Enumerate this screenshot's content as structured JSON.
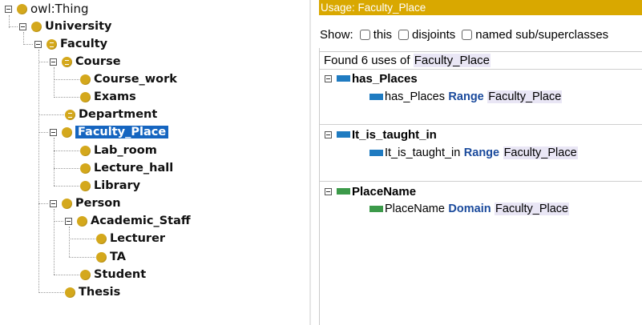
{
  "tree": {
    "root": "owl:Thing",
    "university": "University",
    "faculty": "Faculty",
    "course": "Course",
    "course_work": "Course_work",
    "exams": "Exams",
    "department": "Department",
    "faculty_place": "Faculty_Place",
    "lab_room": "Lab_room",
    "lecture_hall": "Lecture_hall",
    "library": "Library",
    "person": "Person",
    "academic_staff": "Academic_Staff",
    "lecturer": "Lecturer",
    "ta": "TA",
    "student": "Student",
    "thesis": "Thesis"
  },
  "usage": {
    "header": "Usage: Faculty_Place",
    "show_label": "Show:",
    "opt_this": "this",
    "opt_disjoints": "disjoints",
    "opt_named": "named sub/superclasses",
    "found_prefix": "Found 6 uses of",
    "found_entity": "Faculty_Place",
    "groups": [
      {
        "title": "has_Places",
        "prop": "has_Places",
        "kw": "Range",
        "target": "Faculty_Place",
        "color": "#1f7bc1"
      },
      {
        "title": "It_is_taught_in",
        "prop": "It_is_taught_in",
        "kw": "Range",
        "target": "Faculty_Place",
        "color": "#1f7bc1"
      },
      {
        "title": "PlaceName",
        "prop": "PlaceName",
        "kw": "Domain",
        "target": "Faculty_Place",
        "color": "#3c9a4a"
      }
    ]
  }
}
